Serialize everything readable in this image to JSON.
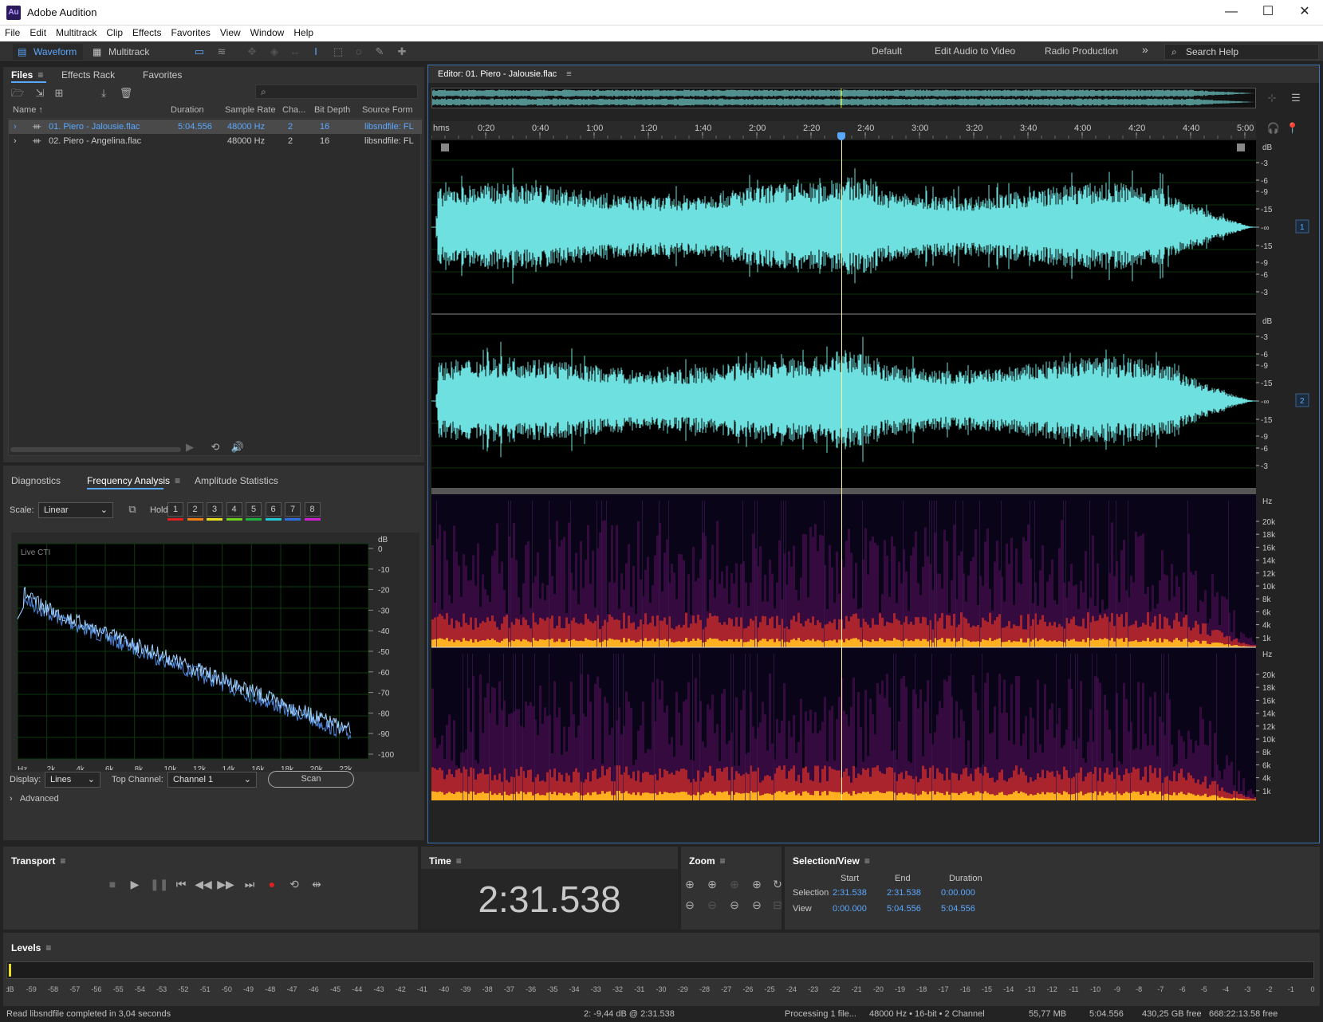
{
  "window": {
    "title": "Adobe Audition",
    "logo": "Au"
  },
  "menu": [
    "File",
    "Edit",
    "Multitrack",
    "Clip",
    "Effects",
    "Favorites",
    "View",
    "Window",
    "Help"
  ],
  "toolbar": {
    "waveform": "Waveform",
    "multitrack": "Multitrack",
    "workspaces": [
      "Default",
      "Edit Audio to Video",
      "Radio Production"
    ],
    "more": "»",
    "search_placeholder": "Search Help"
  },
  "files": {
    "tabs": [
      "Files",
      "Effects Rack",
      "Favorites"
    ],
    "columns": [
      "Name",
      "Duration",
      "Sample Rate",
      "Cha...",
      "Bit Depth",
      "Source Form"
    ],
    "rows": [
      {
        "name": "01. Piero - Jalousie.flac",
        "duration": "5:04.556",
        "rate": "48000 Hz",
        "ch": "2",
        "bits": "16",
        "src": "libsndfile: FL"
      },
      {
        "name": "02. Piero - Angelina.flac",
        "duration": "",
        "rate": "48000 Hz",
        "ch": "2",
        "bits": "16",
        "src": "libsndfile: FL"
      }
    ]
  },
  "analysis": {
    "tabs": [
      "Diagnostics",
      "Frequency Analysis",
      "Amplitude Statistics"
    ],
    "scale_label": "Scale:",
    "scale_value": "Linear",
    "hold_label": "Hold:",
    "holds": [
      "1",
      "2",
      "3",
      "4",
      "5",
      "6",
      "7",
      "8"
    ],
    "hold_colors": [
      "#e02020",
      "#f07f10",
      "#e8e020",
      "#70d020",
      "#20b040",
      "#20c8d8",
      "#3070e0",
      "#d020d0"
    ],
    "graph_label": "Live CTI",
    "db_unit": "dB",
    "db_ticks": [
      "0",
      "-10",
      "-20",
      "-30",
      "-40",
      "-50",
      "-60",
      "-70",
      "-80",
      "-90",
      "-100"
    ],
    "hz_ticks": [
      "Hz",
      "2k",
      "4k",
      "6k",
      "8k",
      "10k",
      "12k",
      "14k",
      "16k",
      "18k",
      "20k",
      "22k"
    ],
    "display_label": "Display:",
    "display_value": "Lines",
    "top_channel_label": "Top Channel:",
    "top_channel_value": "Channel 1",
    "scan": "Scan",
    "advanced": "Advanced"
  },
  "editor": {
    "title": "Editor: 01. Piero - Jalousie.flac",
    "ruler": [
      "hms",
      "0:20",
      "0:40",
      "1:00",
      "1:20",
      "1:40",
      "2:00",
      "2:20",
      "2:40",
      "3:00",
      "3:20",
      "3:40",
      "4:00",
      "4:20",
      "4:40",
      "5:00"
    ],
    "db_unit": "dB",
    "db_scale": [
      "-3",
      "-6",
      "-9",
      "-15",
      "-∞",
      "-15",
      "-9",
      "-6",
      "-3"
    ],
    "channels": [
      "1",
      "2"
    ],
    "hz_unit": "Hz",
    "hz_scale": [
      "20k",
      "18k",
      "16k",
      "14k",
      "12k",
      "10k",
      "8k",
      "6k",
      "4k",
      "1k"
    ],
    "playhead_fraction": 0.497
  },
  "transport": {
    "label": "Transport"
  },
  "time": {
    "label": "Time",
    "value": "2:31.538"
  },
  "zoom": {
    "label": "Zoom"
  },
  "selection": {
    "label": "Selection/View",
    "headers": [
      "Start",
      "End",
      "Duration"
    ],
    "rows": [
      {
        "name": "Selection",
        "start": "2:31.538",
        "end": "2:31.538",
        "duration": "0:00.000"
      },
      {
        "name": "View",
        "start": "0:00.000",
        "end": "5:04.556",
        "duration": "5:04.556"
      }
    ]
  },
  "levels": {
    "label": "Levels",
    "ticks": [
      "dB",
      "-59",
      "-58",
      "-57",
      "-56",
      "-55",
      "-54",
      "-53",
      "-52",
      "-51",
      "-50",
      "-49",
      "-48",
      "-47",
      "-46",
      "-45",
      "-44",
      "-43",
      "-42",
      "-41",
      "-40",
      "-39",
      "-38",
      "-37",
      "-36",
      "-35",
      "-34",
      "-33",
      "-32",
      "-31",
      "-30",
      "-29",
      "-28",
      "-27",
      "-26",
      "-25",
      "-24",
      "-23",
      "-22",
      "-21",
      "-20",
      "-19",
      "-18",
      "-17",
      "-16",
      "-15",
      "-14",
      "-13",
      "-12",
      "-11",
      "-10",
      "-9",
      "-8",
      "-7",
      "-6",
      "-5",
      "-4",
      "-3",
      "-2",
      "-1",
      "0"
    ]
  },
  "status": {
    "left": "Read libsndfile completed in 3,04 seconds",
    "cursor": "2: -9,44 dB @ 2:31.538",
    "processing": "Processing 1 file...",
    "format": "48000 Hz • 16-bit • 2 Channel",
    "size": "55,77 MB",
    "duration": "5:04.556",
    "free": "430,25 GB free",
    "free_time": "668:22:13.58 free"
  }
}
